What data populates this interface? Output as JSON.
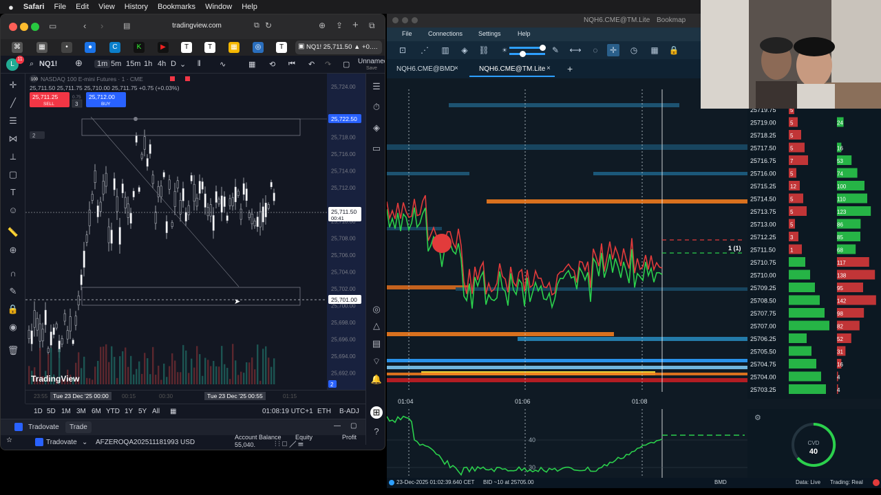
{
  "menubar": {
    "apple": "",
    "app": "Safari",
    "items": [
      "File",
      "Edit",
      "View",
      "History",
      "Bookmarks",
      "Window",
      "Help"
    ]
  },
  "safari": {
    "url": "tradingview.com",
    "active_tab": "NQ1! 25,711.50 ▲ +0.…"
  },
  "tradingview": {
    "symbol": "NQ1!",
    "intervals": [
      "1m",
      "5m",
      "15m",
      "1h",
      "4h",
      "D"
    ],
    "unnamed": "Unnamed",
    "saved": "Save",
    "instrument_title": "NASDAQ 100 E-mini Futures · 1 · CME",
    "ohlc": "25,711.50  25,711.75  25,710.00  25,711.75 +0.75 (+0.03%)",
    "sell_price": "25,711.25",
    "sell_label": "SELL",
    "spread": "0.75",
    "qty": "3",
    "buy_price": "25,712.00",
    "buy_label": "BUY",
    "indicator_count": "2",
    "price_axis": [
      "25,724.00",
      "25,722.50",
      "25,720.00",
      "25,718.00",
      "25,716.00",
      "25,714.00",
      "25,712.00",
      "25,711.00",
      "25,710.00",
      "25,708.00",
      "25,706.00",
      "25,704.00",
      "25,702.00",
      "25,700.00",
      "25,698.00",
      "25,696.00",
      "25,694.00",
      "25,692.00"
    ],
    "last_price_label": "25,711.50",
    "countdown": "00:41",
    "line_price_label": "25,701.00",
    "time_labels": [
      "23:55",
      "Tue 23 Dec '25  00:00",
      "00:15",
      "00:30",
      "Tue 23 Dec '25  00:55",
      "01:15"
    ],
    "periods": [
      "1D",
      "5D",
      "1M",
      "3M",
      "6M",
      "YTD",
      "1Y",
      "5Y",
      "All"
    ],
    "clock": "01:08:19 UTC+1",
    "session": "ETH",
    "adj": "B-ADJ",
    "logo_text": "TradingView",
    "badge": "2",
    "trade_panel": {
      "broker": "Tradovate",
      "trade_btn": "Trade",
      "broker2": "Tradovate",
      "account": "AFZEROQA202511181993 USD",
      "balance_label": "Account Balance",
      "balance_value": "55,040.",
      "equity_label": "Equity",
      "profit_label": "Profit"
    }
  },
  "bookmap": {
    "title": "NQH6.CME@TM.Lite",
    "title_right": "Bookmap",
    "menu": [
      "File",
      "Connections",
      "Settings",
      "Help"
    ],
    "tabs": [
      "NQH6.CME@BMD",
      "NQH6.CME@TM.Lite"
    ],
    "order_marker": "1 (1)",
    "time_labels": [
      "01:04",
      "01:06",
      "01:08"
    ],
    "price_ladder": [
      {
        "price": "25719.75",
        "bid": "5",
        "ask": ""
      },
      {
        "price": "25719.00",
        "bid": "5",
        "ask": "24"
      },
      {
        "price": "25718.25",
        "bid": "5",
        "ask": ""
      },
      {
        "price": "25717.50",
        "bid": "5",
        "ask": "16"
      },
      {
        "price": "25716.75",
        "bid": "7",
        "ask": "53"
      },
      {
        "price": "25716.00",
        "bid": "5",
        "ask": "74"
      },
      {
        "price": "25715.25",
        "bid": "12",
        "ask": "100"
      },
      {
        "price": "25714.50",
        "bid": "5",
        "ask": "110"
      },
      {
        "price": "25713.75",
        "bid": "5",
        "ask": "123"
      },
      {
        "price": "25713.00",
        "bid": "5",
        "ask": "86"
      },
      {
        "price": "25712.25",
        "bid": "3",
        "ask": "85"
      },
      {
        "price": "25711.50",
        "bid": "1",
        "ask": "68"
      },
      {
        "price": "25710.75",
        "bid": "",
        "ask": "117"
      },
      {
        "price": "25710.00",
        "bid": "",
        "ask": "138"
      },
      {
        "price": "25709.25",
        "bid": "",
        "ask": "95"
      },
      {
        "price": "25708.50",
        "bid": "",
        "ask": "142"
      },
      {
        "price": "25707.75",
        "bid": "",
        "ask": "98"
      },
      {
        "price": "25707.00",
        "bid": "",
        "ask": "82"
      },
      {
        "price": "25706.25",
        "bid": "",
        "ask": "52"
      },
      {
        "price": "25705.50",
        "bid": "",
        "ask": "31"
      },
      {
        "price": "25704.75",
        "bid": "",
        "ask": "16"
      },
      {
        "price": "25704.00",
        "bid": "",
        "ask": "4"
      },
      {
        "price": "25703.25",
        "bid": "",
        "ask": "4"
      }
    ],
    "cvd_label": "CVD",
    "cvd_value": "40",
    "cvd_levels": [
      "40",
      "30"
    ],
    "status_left": "23-Dec-2025 01:02:39.640 CET",
    "status_bid": "BID ~10 at 25705.00",
    "status_mid": "BMD",
    "status_data": "Data: Live",
    "status_trading": "Trading: Real"
  },
  "colors": {
    "tv_bg": "#131722",
    "sell": "#f23645",
    "buy": "#2962ff",
    "bid_green": "#2bd04c",
    "ask_red": "#e23b3b",
    "orange": "#f07b1e",
    "bm_bg": "#0f1a24"
  }
}
